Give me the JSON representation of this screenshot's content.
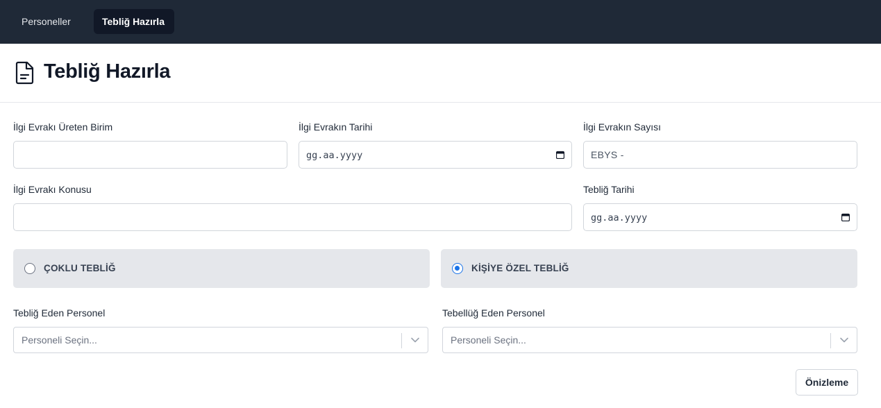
{
  "nav": {
    "items": [
      {
        "label": "Personeller"
      },
      {
        "label": "Tebliğ Hazırla"
      }
    ]
  },
  "header": {
    "icon": "document-icon",
    "title": "Tebliğ Hazırla"
  },
  "form": {
    "birim": {
      "label": "İlgi Evrakı Üreten Birim",
      "value": ""
    },
    "evrak_tarihi": {
      "label": "İlgi Evrakın Tarihi",
      "placeholder": "gg.aa.yyyy"
    },
    "evrak_sayisi": {
      "label": "İlgi Evrakın Sayısı",
      "value": "EBYS -"
    },
    "konu": {
      "label": "İlgi Evrakı Konusu",
      "value": ""
    },
    "teblig_tarihi": {
      "label": "Tebliğ Tarihi",
      "placeholder": "gg.aa.yyyy"
    }
  },
  "teblig_type": {
    "options": [
      {
        "label": "ÇOKLU TEBLİĞ",
        "selected": false
      },
      {
        "label": "KİŞİYE ÖZEL TEBLİĞ",
        "selected": true
      }
    ]
  },
  "personel": {
    "teblig_eden": {
      "label": "Tebliğ Eden Personel",
      "placeholder": "Personeli Seçin..."
    },
    "tebelluq_eden": {
      "label": "Tebellüğ Eden Personel",
      "placeholder": "Personeli Seçin..."
    }
  },
  "actions": {
    "preview_label": "Önizleme"
  },
  "colors": {
    "topbar": "#1f2937",
    "radio_accent": "#1a73e8",
    "card_bg": "#e5e7eb"
  }
}
